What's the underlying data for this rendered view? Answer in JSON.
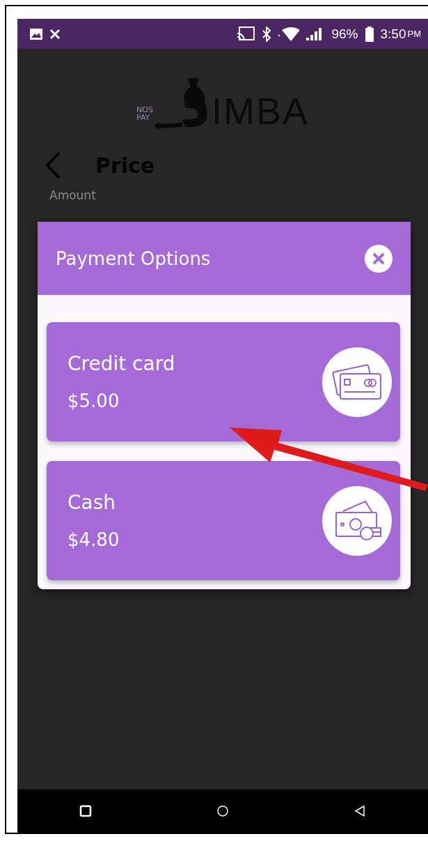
{
  "status_bar": {
    "battery": "96%",
    "time": "3:50",
    "meridiem": "PM"
  },
  "logo": {
    "prefix_top": "NOS",
    "prefix_bottom": "PAY",
    "name": "IMBA"
  },
  "header": {
    "title": "Price"
  },
  "amount_field": {
    "label": "Amount"
  },
  "dialog": {
    "title": "Payment Options",
    "options": [
      {
        "kind": "card",
        "name": "Credit card",
        "price": "$5.00"
      },
      {
        "kind": "cash",
        "name": "Cash",
        "price": "$4.80"
      }
    ]
  }
}
